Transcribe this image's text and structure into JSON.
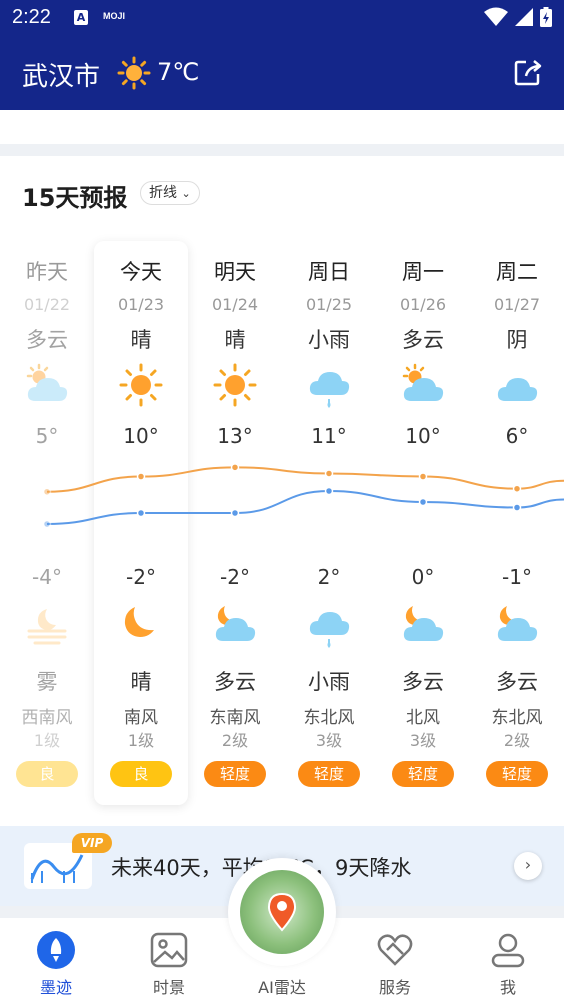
{
  "status_bar": {
    "time": "2:22",
    "a_icon_letter": "A",
    "moji_text": "MOJI"
  },
  "header": {
    "city": "武汉市",
    "weather_icon": "sun-icon",
    "temperature": "7℃"
  },
  "forecast": {
    "title": "15天预报",
    "mode_label": "折线",
    "colors": {
      "day_line": "#f3a34b",
      "night_line": "#5b9ae8",
      "aqi_good": "#ffc412",
      "aqi_light": "#fb8a14"
    },
    "days": [
      {
        "name": "昨天",
        "date": "01/22",
        "day_cond": "多云",
        "day_icon": "partly-cloudy-icon",
        "high": "5°",
        "low": "-4°",
        "night_icon": "fog-icon",
        "night_cond": "雾",
        "wind": "西南风",
        "level": "1级",
        "aqi": "良",
        "past": true
      },
      {
        "name": "今天",
        "date": "01/23",
        "day_cond": "晴",
        "day_icon": "sun-icon",
        "high": "10°",
        "low": "-2°",
        "night_icon": "moon-icon",
        "night_cond": "晴",
        "wind": "南风",
        "level": "1级",
        "aqi": "良",
        "past": false
      },
      {
        "name": "明天",
        "date": "01/24",
        "day_cond": "晴",
        "day_icon": "sun-icon",
        "high": "13°",
        "low": "-2°",
        "night_icon": "moon-cloud-icon",
        "night_cond": "多云",
        "wind": "东南风",
        "level": "2级",
        "aqi": "轻度",
        "past": false
      },
      {
        "name": "周日",
        "date": "01/25",
        "day_cond": "小雨",
        "day_icon": "rain-icon",
        "high": "11°",
        "low": "2°",
        "night_icon": "rain-icon",
        "night_cond": "小雨",
        "wind": "东北风",
        "level": "3级",
        "aqi": "轻度",
        "past": false
      },
      {
        "name": "周一",
        "date": "01/26",
        "day_cond": "多云",
        "day_icon": "partly-cloudy-icon",
        "high": "10°",
        "low": "0°",
        "night_icon": "moon-cloud-icon",
        "night_cond": "多云",
        "wind": "北风",
        "level": "3级",
        "aqi": "轻度",
        "past": false
      },
      {
        "name": "周二",
        "date": "01/27",
        "day_cond": "阴",
        "day_icon": "cloud-icon",
        "high": "6°",
        "low": "-1°",
        "night_icon": "moon-cloud-icon",
        "night_cond": "多云",
        "wind": "东北风",
        "level": "2级",
        "aqi": "轻度",
        "past": false
      }
    ]
  },
  "promo": {
    "vip_label": "VIP",
    "text": "未来40天，平均11℃，9天降水"
  },
  "nav": {
    "items": [
      {
        "label": "墨迹",
        "icon": "rocket-icon",
        "active": true
      },
      {
        "label": "时景",
        "icon": "image-icon",
        "active": false
      },
      {
        "label": "AI雷达",
        "icon": "radar-icon",
        "active": false
      },
      {
        "label": "服务",
        "icon": "heart-icon",
        "active": false
      },
      {
        "label": "我",
        "icon": "user-icon",
        "active": false
      }
    ]
  }
}
